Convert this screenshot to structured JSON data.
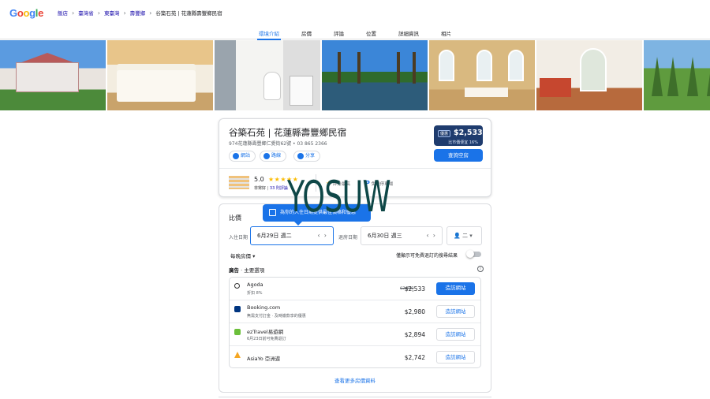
{
  "topbar": {
    "logo": [
      "G",
      "o",
      "o",
      "g",
      "l",
      "e"
    ],
    "logo_colors": [
      "#4285f4",
      "#ea4335",
      "#fbbc05",
      "#4285f4",
      "#34a853",
      "#ea4335"
    ],
    "breadcrumbs": [
      "飯店",
      "臺灣省",
      "東臺灣",
      "壽豐鄉"
    ],
    "current": "谷築石苑 | 花蓮縣壽豐鄉民宿"
  },
  "tabs": [
    {
      "label": "環境介紹",
      "active": true
    },
    {
      "label": "房價",
      "active": false
    },
    {
      "label": "評論",
      "active": false
    },
    {
      "label": "位置",
      "active": false
    },
    {
      "label": "詳細資訊",
      "active": false
    },
    {
      "label": "相片",
      "active": false
    }
  ],
  "hotel": {
    "name": "谷築石苑 | 花蓮縣壽豐鄉民宿",
    "address": "974花蓮縣壽豐鄉仁愛街62號 • 03 865 2366",
    "deal_badge": "優惠",
    "price": "$2,533",
    "price_note": "比市價便宜 16%",
    "check_button": "查詢空房",
    "actions": {
      "website": "網站",
      "route": "路線",
      "share": "分享"
    },
    "rating": "5.0",
    "stars": "★★★★★",
    "rating_word": "非常好",
    "reviews": "33 則評論",
    "feature1": "評分最高",
    "feature2": "免費停車場"
  },
  "watermark": "YOSUW",
  "pricing": {
    "title": "比價",
    "tooltip": "為你的入住日期提供最佳價格和優惠",
    "checkin_label": "入住日期",
    "checkin": "6月29日 週二",
    "checkout_label": "退房日期",
    "checkout": "6月30日 週三",
    "guests": "二",
    "nightly": "每晚房價",
    "free_cancel": "僅顯示可免費退訂的搜尋結果",
    "ads_label": "廣告",
    "ads_title": "主要選項",
    "offers": [
      {
        "name": "Agoda",
        "sub": "折扣 8%",
        "old": "$2,742",
        "price": "$2,533",
        "button": "造訪網站",
        "primary": true,
        "logo_color": "#ffffff"
      },
      {
        "name": "Booking.com",
        "sub": "無需支付訂金 · 及時繳款享的優惠",
        "old": "",
        "price": "$2,980",
        "button": "造訪網站",
        "primary": false,
        "logo_color": "#003580"
      },
      {
        "name": "ezTravel易遊網",
        "sub": "6月23日前可免費退訂",
        "old": "",
        "price": "$2,894",
        "button": "造訪網站",
        "primary": false,
        "logo_color": "#6bbf3a"
      },
      {
        "name": "AsiaYo 亞洲遊",
        "sub": "",
        "old": "",
        "price": "$2,742",
        "button": "造訪網站",
        "primary": false,
        "logo_color": "#f5a623"
      }
    ],
    "more": "查看更多房價資料"
  }
}
